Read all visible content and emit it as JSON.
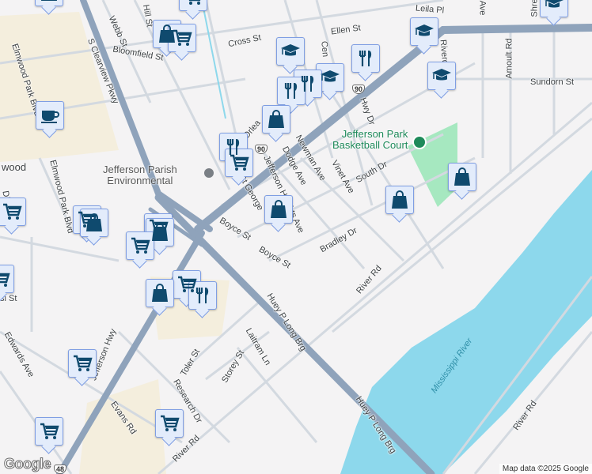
{
  "map": {
    "streets": {
      "hill": "Hill St",
      "webb": "Webb St",
      "bloomfield": "Bloomfield St",
      "cross": "Cross St",
      "ellen": "Ellen St",
      "leila": "Leila Pl",
      "central": "Cen",
      "riverd": "Riverd",
      "amoult": "Amoult Rd",
      "sundorn": "Sundorn St",
      "ave_top": "Ave",
      "shre": "Shre",
      "clearview": "S Clearview Pkwy",
      "elmwood1": "Elmwood Park Blvd",
      "elmwood2": "Elmwood Park Blvd",
      "elmwood_cut": "wood",
      "orleans": "Orlea",
      "hwy_dr": "Hwy Dr",
      "dodge": "Dodge Ave",
      "newman": "Newman Ave",
      "vinet": "Vinet Ave",
      "south": "South Dr",
      "jefferson_heights": "Jefferson Heights Ave",
      "st_george": "St George",
      "boyce1": "Boyce St",
      "boyce2": "Boyce St",
      "bradley": "Bradley Dr",
      "river_rd1": "River Rd",
      "huey1": "Huey P Long Brg",
      "huey2": "Huey P Long Brg",
      "laitram": "Laitram Ln",
      "toler": "Toler St",
      "storey": "Storey St",
      "research": "Research Dr",
      "edwards": "Edwards Ave",
      "jefferson_hwy": "Jefferson Hwy",
      "evans": "Evans Rd",
      "river_rd2": "River Rd",
      "river_rd3": "River Rd",
      "district": "Distri",
      "si_st": "si St"
    },
    "water": {
      "mississippi": "Mississippi River"
    },
    "places": {
      "jp_environmental_line1": "Jefferson Parish",
      "jp_environmental_line2": "Environmental",
      "basketball_line1": "Jefferson Park",
      "basketball_line2": "Basketball Court"
    },
    "shields": {
      "us90_a": "90",
      "us90_b": "90",
      "la48": "48"
    },
    "colors": {
      "land": "#f4f3f4",
      "water": "#8dd8ec",
      "park": "#a6e8c0",
      "highway": "#8fa3bb",
      "road": "#d3d9e0",
      "marker": "#0f4a6e",
      "commercial": "#f4eedd"
    },
    "markers": [
      {
        "type": "cart",
        "label": "Grocery store"
      },
      {
        "type": "bag",
        "label": "Shopping"
      },
      {
        "type": "cart",
        "label": "Grocery store"
      },
      {
        "type": "bag",
        "label": "Shopping"
      },
      {
        "type": "school",
        "label": "School"
      },
      {
        "type": "school",
        "label": "School"
      },
      {
        "type": "school",
        "label": "School"
      },
      {
        "type": "school",
        "label": "School"
      },
      {
        "type": "school",
        "label": "School"
      },
      {
        "type": "fork",
        "label": "Restaurant"
      },
      {
        "type": "fork",
        "label": "Restaurant"
      },
      {
        "type": "fork",
        "label": "Restaurant"
      },
      {
        "type": "bag",
        "label": "Shopping"
      },
      {
        "type": "fork",
        "label": "Restaurant"
      },
      {
        "type": "cart",
        "label": "Grocery store"
      },
      {
        "type": "bag",
        "label": "Shopping"
      },
      {
        "type": "bag",
        "label": "Shopping"
      },
      {
        "type": "bag",
        "label": "Shopping"
      },
      {
        "type": "coffee",
        "label": "Cafe"
      },
      {
        "type": "cart",
        "label": "Grocery store"
      },
      {
        "type": "cart",
        "label": "Grocery store"
      },
      {
        "type": "bag",
        "label": "Shopping"
      },
      {
        "type": "cart",
        "label": "Grocery store"
      },
      {
        "type": "bag",
        "label": "Shopping"
      },
      {
        "type": "cart",
        "label": "Grocery store"
      },
      {
        "type": "cart",
        "label": "Grocery store"
      },
      {
        "type": "bag",
        "label": "Shopping"
      },
      {
        "type": "fork",
        "label": "Restaurant"
      },
      {
        "type": "cart",
        "label": "Grocery store"
      },
      {
        "type": "cart",
        "label": "Grocery store"
      },
      {
        "type": "cart",
        "label": "Grocery store"
      },
      {
        "type": "cart",
        "label": "Grocery store"
      }
    ],
    "attribution": "Map data ©2025 Google",
    "logo": "Google"
  }
}
